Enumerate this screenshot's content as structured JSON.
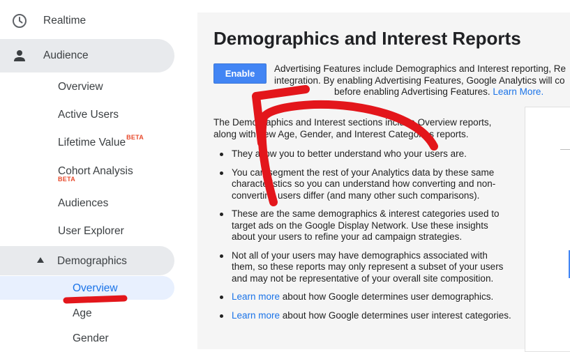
{
  "sidebar": {
    "realtime": "Realtime",
    "audience": "Audience",
    "audience_items": [
      "Overview",
      "Active Users",
      "Lifetime Value",
      "Cohort Analysis",
      "Audiences",
      "User Explorer"
    ],
    "beta": "BETA",
    "demographics": "Demographics",
    "demographics_items": [
      "Overview",
      "Age",
      "Gender"
    ]
  },
  "main": {
    "title": "Demographics and Interest Reports",
    "enable_label": "Enable",
    "advertising": {
      "line1": "Advertising Features include Demographics and Interest reporting, Re",
      "line2": "integration. By enabling Advertising Features, Google Analytics will co",
      "line3": "before enabling Advertising Features.",
      "learn_more": "Learn More."
    },
    "intro": "The Demographics and Interest sections include Overview reports, along with new Age, Gender, and Interest Categories reports.",
    "bullets": [
      "They allow you to better understand who your users are.",
      "You can segment the rest of your Analytics data by these same characteristics so you can understand how converting and non-converting users differ (and many other such comparisons).",
      "These are the same demographics & interest categories used to target ads on the Google Display Network. Use these insights about your users to refine your ad campaign strategies.",
      "Not all of your users may have demographics associated with them, so these reports may only represent a subset of your users and may not be representative of your overall site composition."
    ],
    "learn_bullets": [
      {
        "link": "Learn more",
        "text": " about how Google determines user demographics."
      },
      {
        "link": "Learn more",
        "text": " about how Google determines user interest categories."
      }
    ]
  },
  "colors": {
    "accent": "#4285f4",
    "link": "#1a73e8",
    "annotation": "#e3161b",
    "beta": "#e8492b"
  }
}
